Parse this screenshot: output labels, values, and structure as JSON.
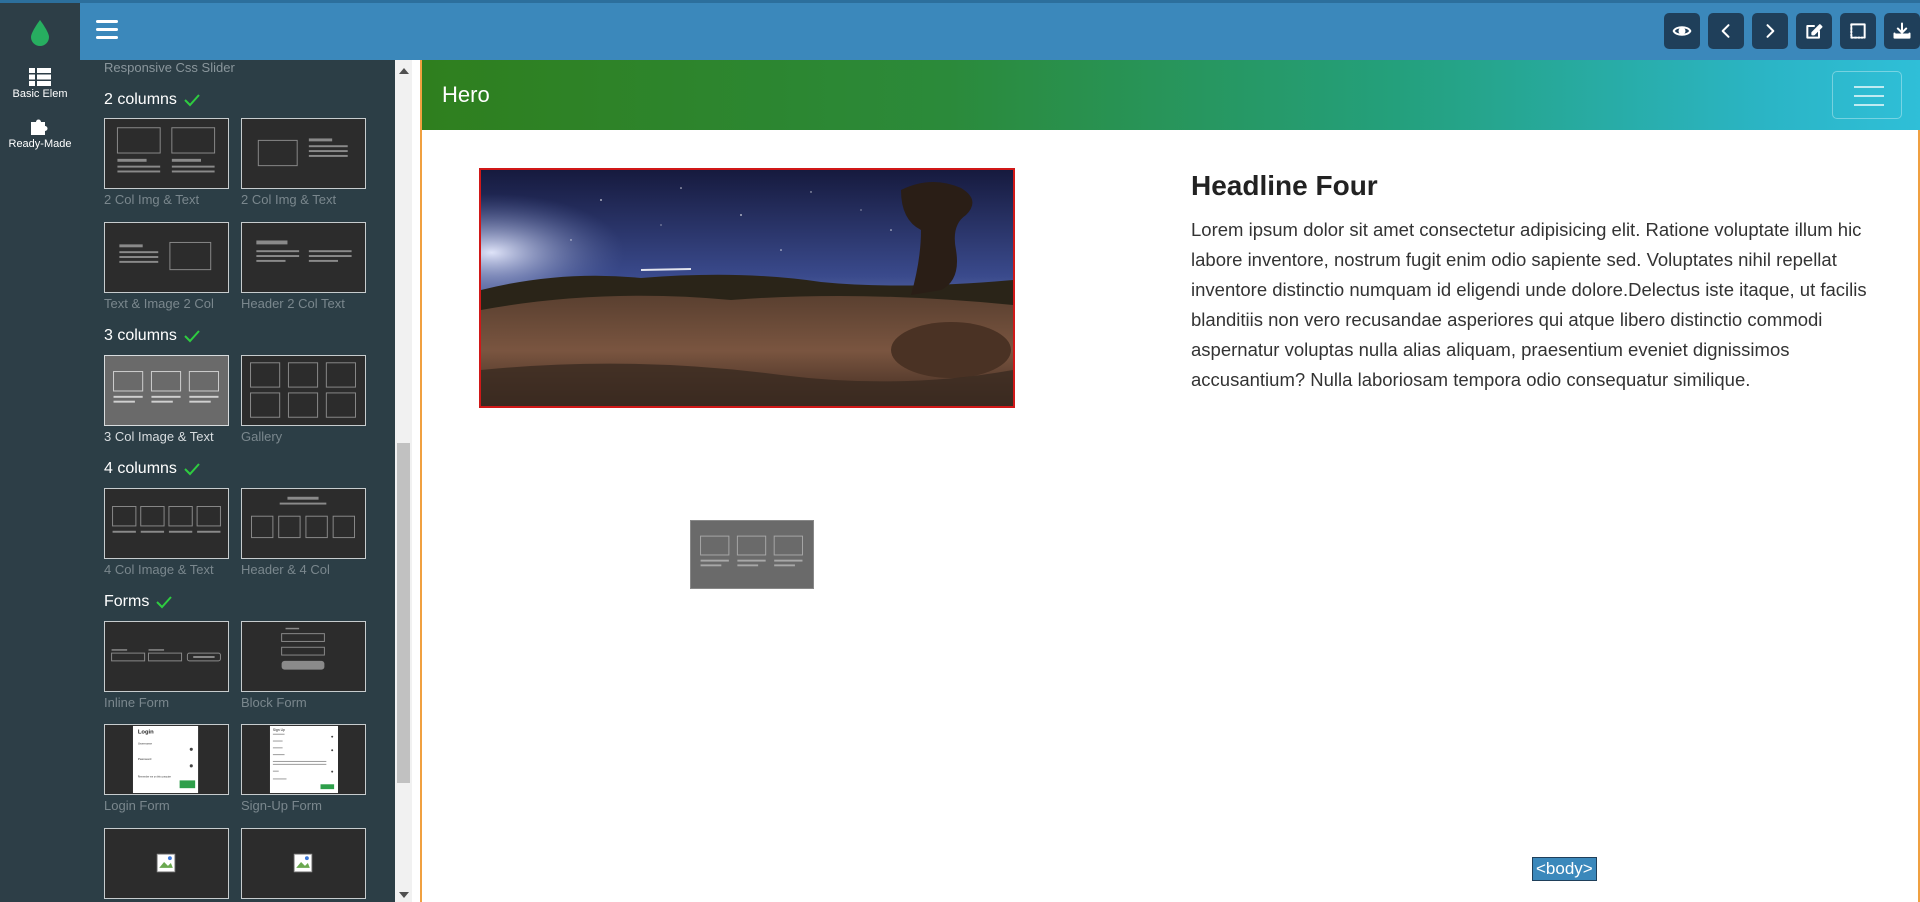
{
  "topbar": {
    "tools": [
      {
        "icon": "eye-icon",
        "name": "preview-button"
      },
      {
        "icon": "chevron-left-icon",
        "name": "undo-button"
      },
      {
        "icon": "chevron-right-icon",
        "name": "redo-button"
      },
      {
        "icon": "edit-icon",
        "name": "edit-code-button"
      },
      {
        "icon": "border-icon",
        "name": "toggle-borders-button"
      },
      {
        "icon": "download-icon",
        "name": "download-button"
      }
    ]
  },
  "rail": {
    "items": [
      {
        "label": "Basic Elem",
        "icon": "table-icon"
      },
      {
        "label": "Ready-Made",
        "icon": "puzzle-icon"
      }
    ]
  },
  "panel": {
    "top_caption": "Responsive Css Slider",
    "sections": {
      "two_columns": "2 columns",
      "three_columns": "3 columns",
      "four_columns": "4 columns",
      "forms": "Forms"
    },
    "blocks": {
      "two_col_img_text_a": "2 Col Img & Text",
      "two_col_img_text_b": "2 Col Img & Text",
      "text_image_2col": "Text & Image 2 Col",
      "header_2col_text": "Header 2 Col Text",
      "three_col_image_text": "3 Col Image & Text",
      "gallery": "Gallery",
      "four_col_image_text": "4 Col Image & Text",
      "header_4col": "Header & 4 Col",
      "inline_form": "Inline Form",
      "block_form": "Block Form",
      "login_form": "Login Form",
      "signup_form": "Sign-Up Form"
    },
    "login_thumb": {
      "title": "Login",
      "username": "Username",
      "password": "Password",
      "remember": "Remember me on this computer"
    },
    "signup_thumb": {
      "title": "Sign Up"
    }
  },
  "canvas": {
    "hero_title": "Hero",
    "headline": "Headline Four",
    "paragraph": "Lorem ipsum dolor sit amet consectetur adipisicing elit. Ratione voluptate illum hic labore inventore, nostrum fugit enim odio sapiente sed. Voluptates nihil repellat inventore distinctio numquam id eligendi unde dolore.Delectus iste itaque, ut facilis blanditiis non vero recusandae asperiores qui atque libero distinctio commodi aspernatur voluptas nulla alias aliquam, praesentium eveniet dignissimos accusantium? Nulla laboriosam tempora odio consequatur similique.",
    "body_tag": "<body>"
  },
  "colors": {
    "topbar": "#3b88bb",
    "sidebar": "#2c3e46",
    "check": "#2ecc40",
    "selection_border": "#d01818",
    "canvas_outline": "#f0a040"
  }
}
